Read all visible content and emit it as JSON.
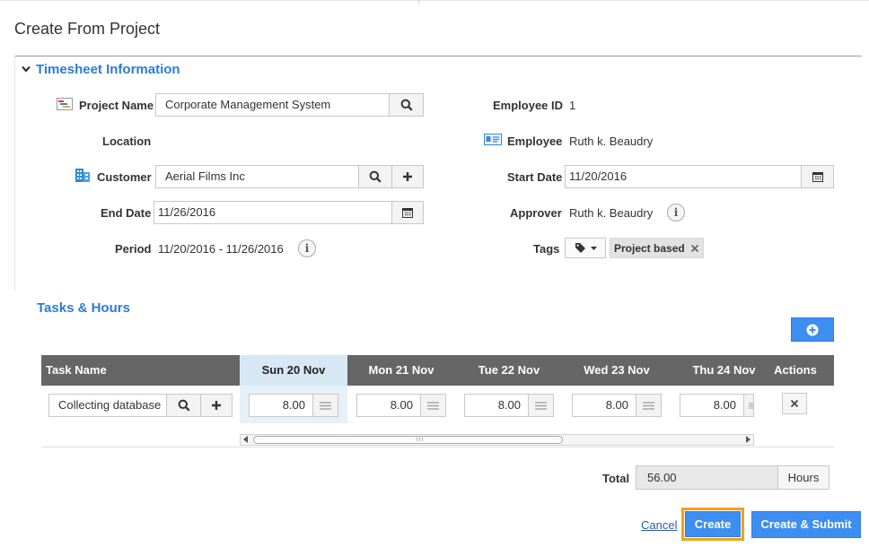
{
  "dialog": {
    "title": "Create From Project"
  },
  "timesheet_info": {
    "title": "Timesheet Information",
    "project_name": {
      "label": "Project Name",
      "value": "Corporate Management System"
    },
    "location": {
      "label": "Location"
    },
    "customer": {
      "label": "Customer",
      "value": "Aerial Films Inc"
    },
    "end_date": {
      "label": "End Date",
      "value": "11/26/2016"
    },
    "period": {
      "label": "Period",
      "value": "11/20/2016 - 11/26/2016"
    },
    "employee_id": {
      "label": "Employee ID",
      "value": "1"
    },
    "employee": {
      "label": "Employee",
      "value": "Ruth k. Beaudry"
    },
    "start_date": {
      "label": "Start Date",
      "value": "11/20/2016"
    },
    "approver": {
      "label": "Approver",
      "value": "Ruth k. Beaudry"
    },
    "tags": {
      "label": "Tags",
      "items": [
        "Project based"
      ]
    },
    "info_glyph": "i"
  },
  "tasks": {
    "title": "Tasks & Hours",
    "columns": [
      "Task Name",
      "Sun 20 Nov",
      "Mon 21 Nov",
      "Tue 22 Nov",
      "Wed 23 Nov",
      "Thu 24 Nov",
      "Actions"
    ],
    "rows": [
      {
        "task": "Collecting database",
        "hours": [
          "8.00",
          "8.00",
          "8.00",
          "8.00",
          "8.00"
        ]
      }
    ],
    "scroll_grip": "III"
  },
  "total": {
    "label": "Total",
    "value": "56.00",
    "unit": "Hours"
  },
  "actions": {
    "cancel": "Cancel",
    "create": "Create",
    "create_submit": "Create & Submit"
  },
  "colors": {
    "accent": "#2b7bd9",
    "primary_button": "#3d8ef0",
    "focus_outline": "#f0a21a",
    "header_bg": "#666666",
    "header_highlight": "#d7e7f4"
  },
  "icons": [
    "chevron-down-icon",
    "project-icon",
    "search-icon",
    "customer-building-icon",
    "plus-icon",
    "calendar-icon",
    "employee-card-icon",
    "info-icon",
    "tag-icon",
    "close-icon",
    "lines-icon",
    "add-circle-icon"
  ]
}
